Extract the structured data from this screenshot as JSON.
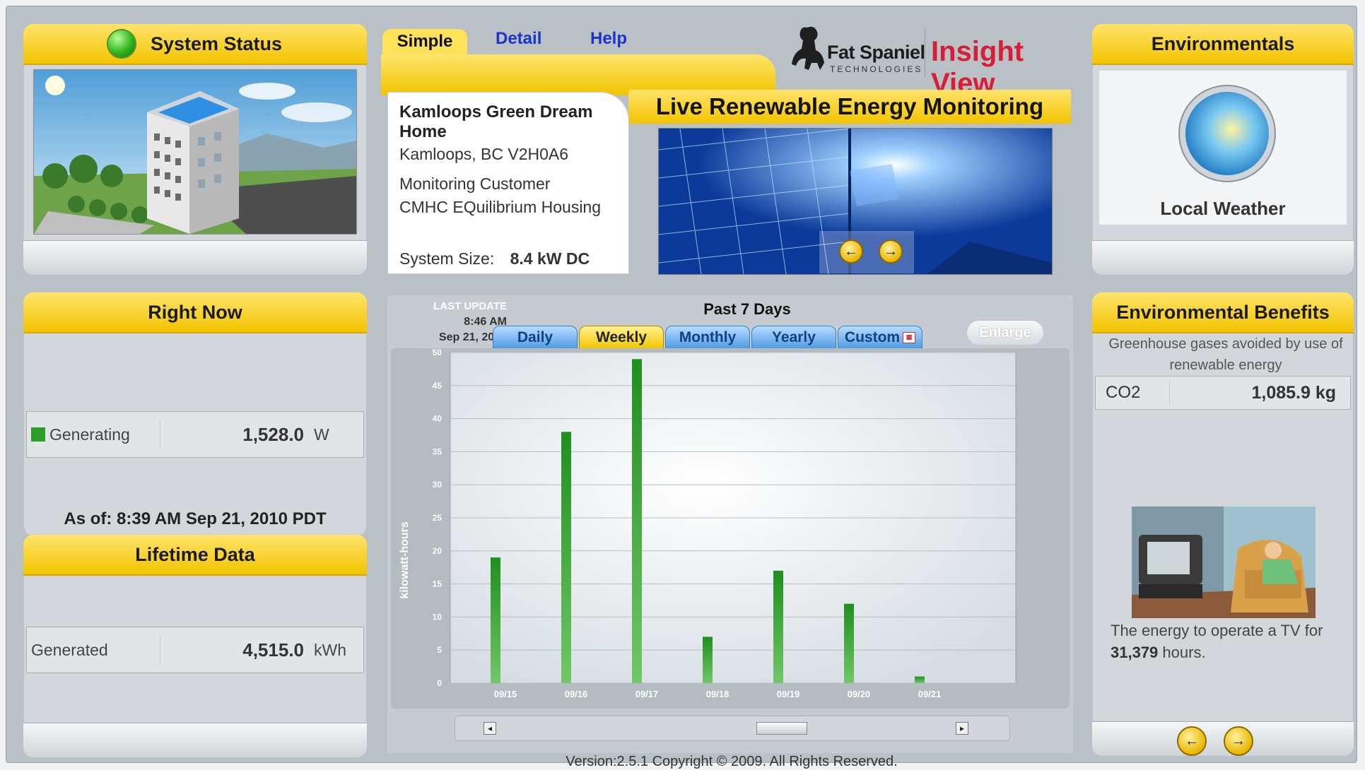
{
  "system_status": {
    "title": "System Status"
  },
  "tabs": {
    "simple": "Simple",
    "detail": "Detail",
    "help": "Help"
  },
  "brand": {
    "logo_company": "Fat Spaniel",
    "logo_sub": "TECHNOLOGIES",
    "product": "Insight View",
    "tagline": "Live Renewable Energy Monitoring"
  },
  "site": {
    "name": "Kamloops Green Dream Home",
    "location": "Kamloops, BC V2H0A6",
    "customer_label": "Monitoring Customer",
    "customer": "CMHC EQuilibrium Housing",
    "size_label": "System Size:",
    "size_value": "8.4 kW DC"
  },
  "environmentals": {
    "title": "Environmentals",
    "weather_label": "Local Weather"
  },
  "right_now": {
    "title": "Right Now",
    "generating_label": "Generating",
    "generating_value": "1,528.0",
    "generating_unit": "W",
    "as_of": "As of: 8:39 AM Sep 21, 2010 PDT"
  },
  "lifetime": {
    "title": "Lifetime Data",
    "generated_label": "Generated",
    "generated_value": "4,515.0",
    "generated_unit": "kWh"
  },
  "chart_panel": {
    "last_update_label": "LAST UPDATE",
    "last_update_time": "8:46 AM",
    "last_update_date": "Sep 21, 2010",
    "tabs": [
      "Daily",
      "Weekly",
      "Monthly",
      "Yearly",
      "Custom"
    ],
    "active_tab": "Weekly",
    "enlarge": "Enlarge"
  },
  "chart_data": {
    "type": "bar",
    "title": "Past 7 Days",
    "ylabel": "kilowatt-hours",
    "xlabel": "",
    "categories": [
      "09/15",
      "09/16",
      "09/17",
      "09/18",
      "09/19",
      "09/20",
      "09/21"
    ],
    "values": [
      19,
      38,
      49,
      7,
      17,
      12,
      1
    ],
    "ylim": [
      0,
      50
    ],
    "yticks": [
      0,
      5,
      10,
      15,
      20,
      25,
      30,
      35,
      40,
      45,
      50
    ],
    "color": "#2e9e2a",
    "grid": true
  },
  "footer": {
    "version": "Version:2.5.1   Copyright © 2009. All Rights Reserved."
  },
  "benefits": {
    "title": "Environmental Benefits",
    "description": "Greenhouse gases avoided by use of renewable energy",
    "co2_label": "CO2",
    "co2_value": "1,085.9 kg",
    "tv_text_pre": "The energy to operate a TV for",
    "tv_hours": "31,379",
    "tv_text_post": "hours."
  },
  "colors": {
    "accent_yellow": "#f2c400",
    "brand_red": "#d81e37",
    "bar_green": "#2e9e2a",
    "tab_blue": "#4d9be2"
  }
}
